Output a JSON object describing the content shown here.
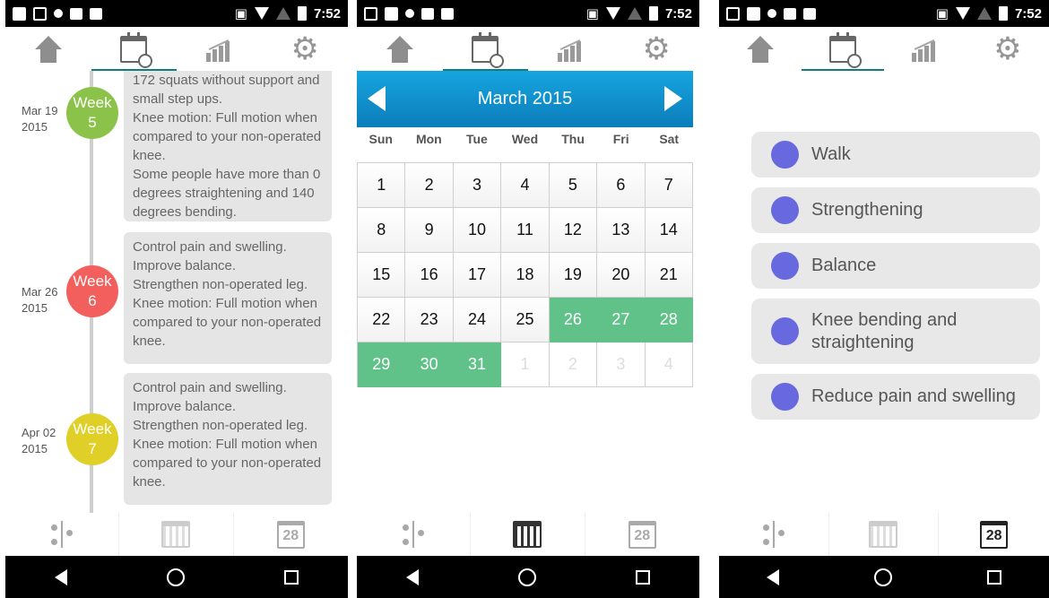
{
  "status_time": "7:52",
  "screens": [
    {
      "entries": [
        {
          "date": "Mar 19\n2015",
          "week": "Week\n5",
          "color": "#8bc34a",
          "text": "172 squats without support and small step ups.\nKnee motion: Full motion when compared to your non-operated knee.\nSome people have more than 0 degrees straightening and 140 degrees bending."
        },
        {
          "date": "Mar 26\n2015",
          "week": "Week\n6",
          "color": "#f25f5c",
          "text": "Control pain and swelling.\nImprove balance.\nStrengthen non-operated leg.\nKnee motion: Full motion when compared to your non-operated knee."
        },
        {
          "date": "Apr 02\n2015",
          "week": "Week\n7",
          "color": "#dfcf26",
          "text": "Control pain and swelling.\nImprove balance.\nStrengthen non-operated leg.\nKnee motion: Full motion when compared to your non-operated knee."
        }
      ]
    },
    {
      "month": "March 2015",
      "weekdays": [
        "Sun",
        "Mon",
        "Tue",
        "Wed",
        "Thu",
        "Fri",
        "Sat"
      ],
      "days": [
        "1",
        "2",
        "3",
        "4",
        "5",
        "6",
        "7",
        "8",
        "9",
        "10",
        "11",
        "12",
        "13",
        "14",
        "15",
        "16",
        "17",
        "18",
        "19",
        "20",
        "21",
        "22",
        "23",
        "24",
        "25",
        "26",
        "27",
        "28",
        "29",
        "30",
        "31",
        "1",
        "2",
        "3",
        "4"
      ]
    },
    {
      "exercises": [
        "Walk",
        "Strengthening",
        "Balance",
        "Knee bending and\nstraightening",
        "Reduce pain and swelling"
      ]
    }
  ],
  "bottom_badge": "28"
}
